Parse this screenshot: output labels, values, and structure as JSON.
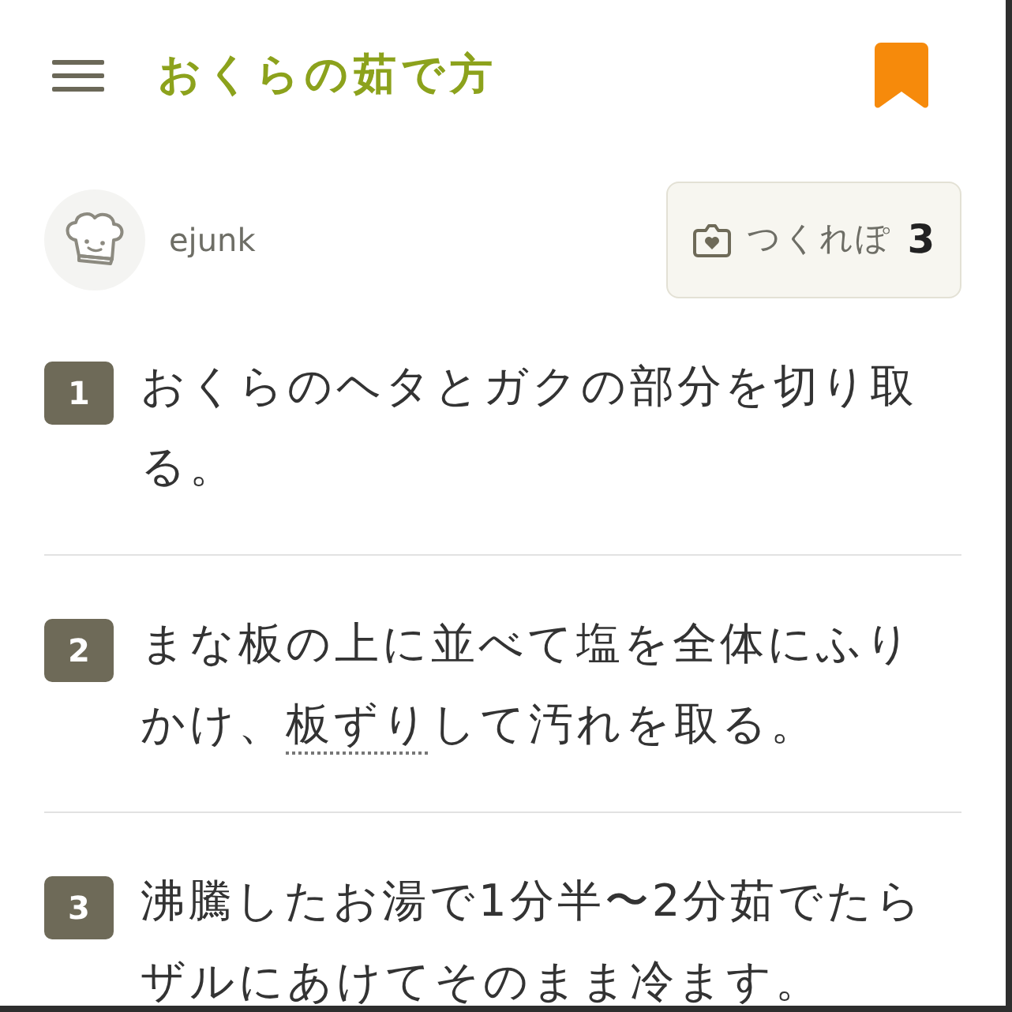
{
  "header": {
    "title": "おくらの茹で方"
  },
  "author": {
    "name": "ejunk"
  },
  "tsukurepo_button": {
    "label": "つくれぽ",
    "count": "3"
  },
  "steps": [
    {
      "number": "1",
      "segments": [
        {
          "kind": "text",
          "text": "おくらのヘタとガクの部分を切り取る。"
        }
      ]
    },
    {
      "number": "2",
      "segments": [
        {
          "kind": "text",
          "text": "まな板の上に並べて塩を全体にふりかけ、"
        },
        {
          "kind": "term",
          "text": "板ずり"
        },
        {
          "kind": "text",
          "text": "して汚れを取る。"
        }
      ]
    },
    {
      "number": "3",
      "segments": [
        {
          "kind": "text",
          "text": "沸騰したお湯で1分半〜2分茹でたらザルにあけてそのまま冷ます。"
        }
      ]
    }
  ]
}
